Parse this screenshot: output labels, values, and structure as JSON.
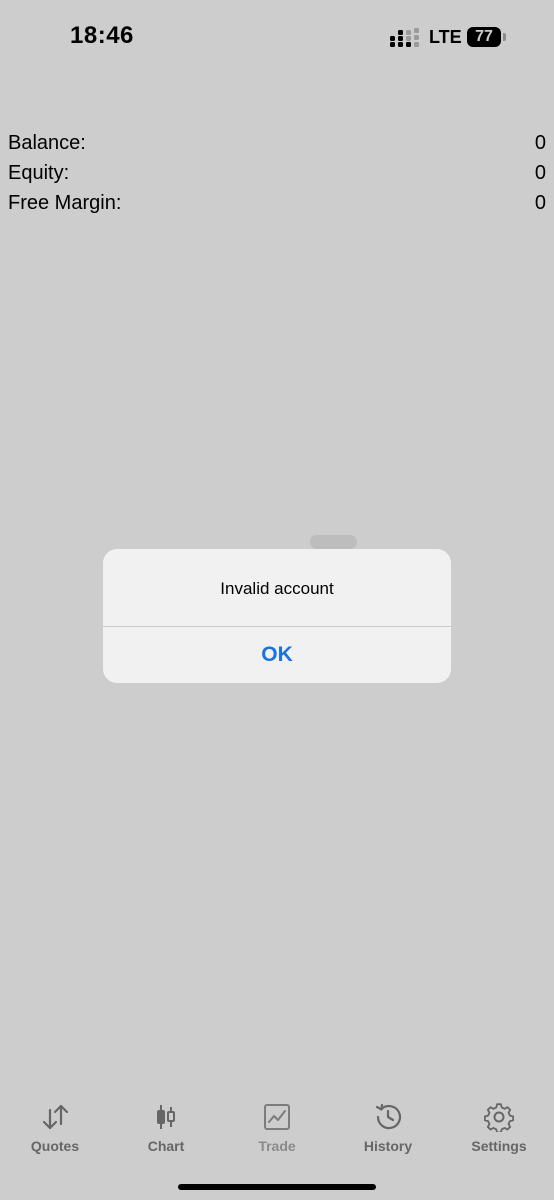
{
  "status_bar": {
    "time": "18:46",
    "network": "LTE",
    "battery": "77"
  },
  "account": {
    "rows": [
      {
        "label": "Balance:",
        "value": "0"
      },
      {
        "label": "Equity:",
        "value": "0"
      },
      {
        "label": "Free Margin:",
        "value": "0"
      }
    ]
  },
  "alert": {
    "message": "Invalid account",
    "ok_label": "OK",
    "ok_color": "#1a73e0"
  },
  "tabs": [
    {
      "label": "Quotes",
      "icon": "quotes-arrows-icon"
    },
    {
      "label": "Chart",
      "icon": "candlestick-icon"
    },
    {
      "label": "Trade",
      "icon": "trade-chart-icon"
    },
    {
      "label": "History",
      "icon": "history-clock-icon"
    },
    {
      "label": "Settings",
      "icon": "gear-icon"
    }
  ]
}
